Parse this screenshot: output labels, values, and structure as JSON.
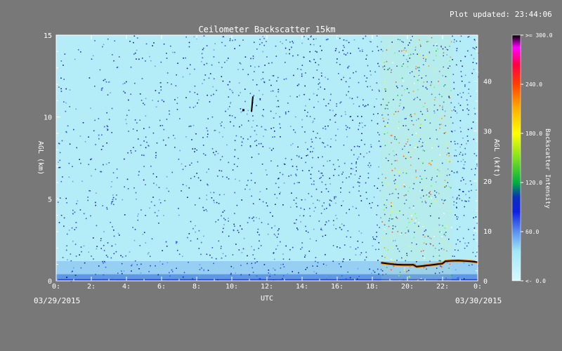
{
  "plot_updated": "Plot updated: 23:44:06",
  "chart_data": {
    "type": "heatmap",
    "title": "Ceilometer Backscatter 15km",
    "xlabel": "UTC",
    "ylabel_left": "AGL (km)",
    "ylabel_right": "AGL (kft)",
    "colorbar_label": "Backscatter Intensity",
    "x_ticks": [
      "0:",
      "2:",
      "4:",
      "6:",
      "8:",
      "10:",
      "12:",
      "14:",
      "16:",
      "18:",
      "20:",
      "22:",
      "0:"
    ],
    "xlim_hours": [
      0,
      24
    ],
    "y_ticks_km": [
      0,
      5,
      10,
      15
    ],
    "ylim_km": [
      0,
      15
    ],
    "y_ticks_kft": [
      0,
      10,
      20,
      30,
      40
    ],
    "colorbar_ticks": [
      "<- 0.0",
      "60.0",
      "120.0",
      "180.0",
      "240.0",
      ">= 300.0"
    ],
    "colorbar_range": [
      0,
      300
    ],
    "start_date": "03/29/2015",
    "end_date": "03/30/2015",
    "features": {
      "boundary_layer_top_km": 1.2,
      "noisy_period_utc_hours": [
        18.5,
        22.5
      ],
      "cloud_layer_utc_hours": [
        18.5,
        24
      ],
      "cloud_layer_height_km": 1.1,
      "isolated_cloud_utc_hours": [
        10.6,
        11.2
      ],
      "isolated_cloud_height_km": 10.4
    },
    "colors": {
      "background": "#787878",
      "low": "#c8f4fc",
      "mid": "#1a3cd0",
      "high": "#ff00ff"
    }
  }
}
